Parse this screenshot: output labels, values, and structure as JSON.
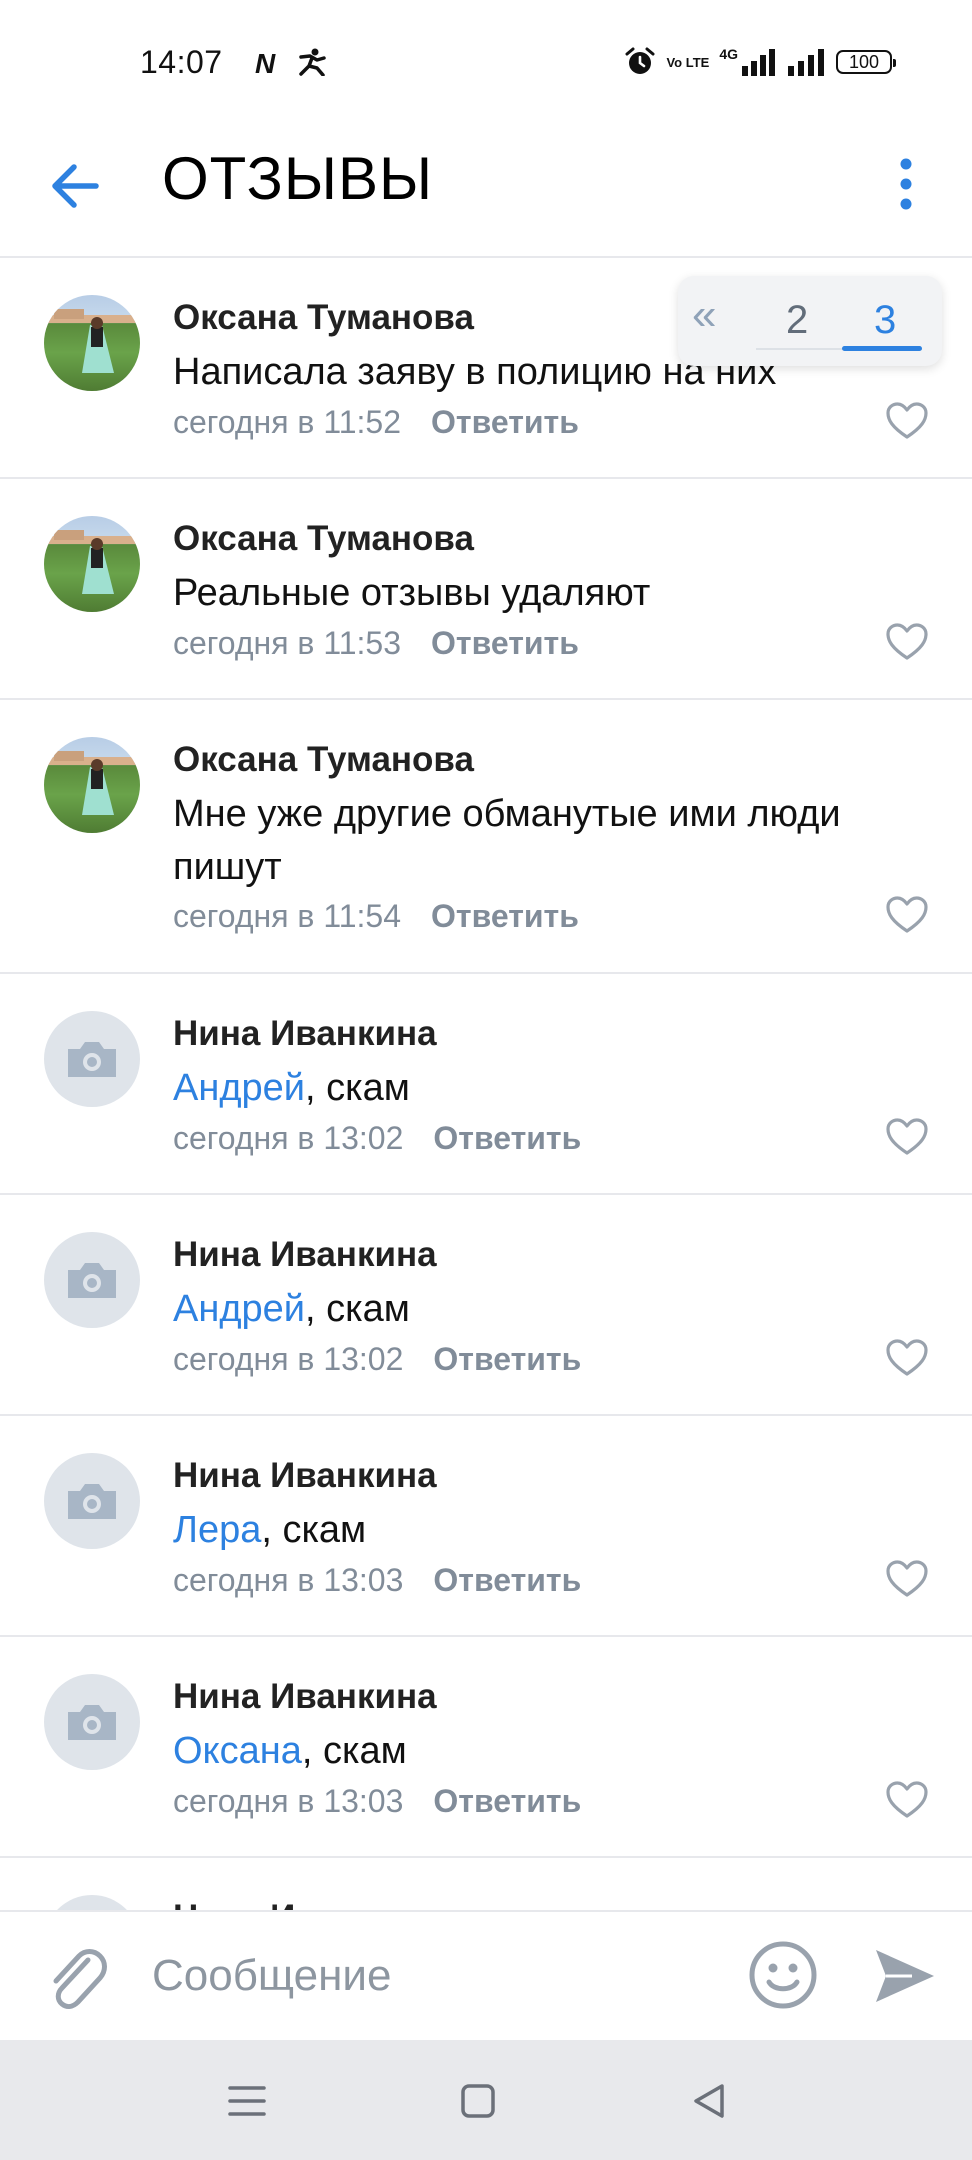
{
  "status_bar": {
    "time": "14:07",
    "left_icons": [
      "n-icon",
      "runner-icon"
    ],
    "right_icons": [
      "alarm-icon",
      "volte-icon",
      "signal-4g-icon",
      "signal-icon"
    ],
    "volte_label": "Vo LTE",
    "network": "4G",
    "battery": "100"
  },
  "header": {
    "title": "ОТЗЫВЫ",
    "back_icon": "arrow-left-icon",
    "menu_icon": "more-vertical-icon"
  },
  "pager": {
    "prev_icon": "double-chevron-left-icon",
    "pages": [
      "2",
      "3"
    ],
    "active": "3"
  },
  "comments": [
    {
      "author": "Оксана Туманова",
      "mention": "",
      "text": "Написала заяву в полицию на них",
      "time": "сегодня в 11:52",
      "reply": "Ответить",
      "avatar": "photo"
    },
    {
      "author": "Оксана Туманова",
      "mention": "",
      "text": "Реальные отзывы удаляют",
      "time": "сегодня в 11:53",
      "reply": "Ответить",
      "avatar": "photo"
    },
    {
      "author": "Оксана Туманова",
      "mention": "",
      "text": "Мне уже другие обманутые ими люди пишут",
      "time": "сегодня в 11:54",
      "reply": "Ответить",
      "avatar": "photo"
    },
    {
      "author": "Нина Иванкина",
      "mention": "Андрей",
      "text": ", скам",
      "time": "сегодня в 13:02",
      "reply": "Ответить",
      "avatar": "camera"
    },
    {
      "author": "Нина Иванкина",
      "mention": "Андрей",
      "text": ", скам",
      "time": "сегодня в 13:02",
      "reply": "Ответить",
      "avatar": "camera"
    },
    {
      "author": "Нина Иванкина",
      "mention": "Лера",
      "text": ", скам",
      "time": "сегодня в 13:03",
      "reply": "Ответить",
      "avatar": "camera"
    },
    {
      "author": "Нина Иванкина",
      "mention": "Оксана",
      "text": ", скам",
      "time": "сегодня в 13:03",
      "reply": "Ответить",
      "avatar": "camera"
    },
    {
      "author": "Нина Иванкина",
      "mention": "",
      "text": "",
      "time": "",
      "reply": "",
      "avatar": "camera"
    }
  ],
  "compose": {
    "placeholder": "Сообщение",
    "attach_icon": "paperclip-icon",
    "emoji_icon": "smile-icon",
    "send_icon": "send-icon"
  },
  "nav": {
    "icons": [
      "menu-icon",
      "home-square-icon",
      "back-triangle-icon"
    ]
  },
  "colors": {
    "accent": "#2d81e0",
    "secondary_text": "#818c99",
    "separator": "#e7e8ec"
  }
}
